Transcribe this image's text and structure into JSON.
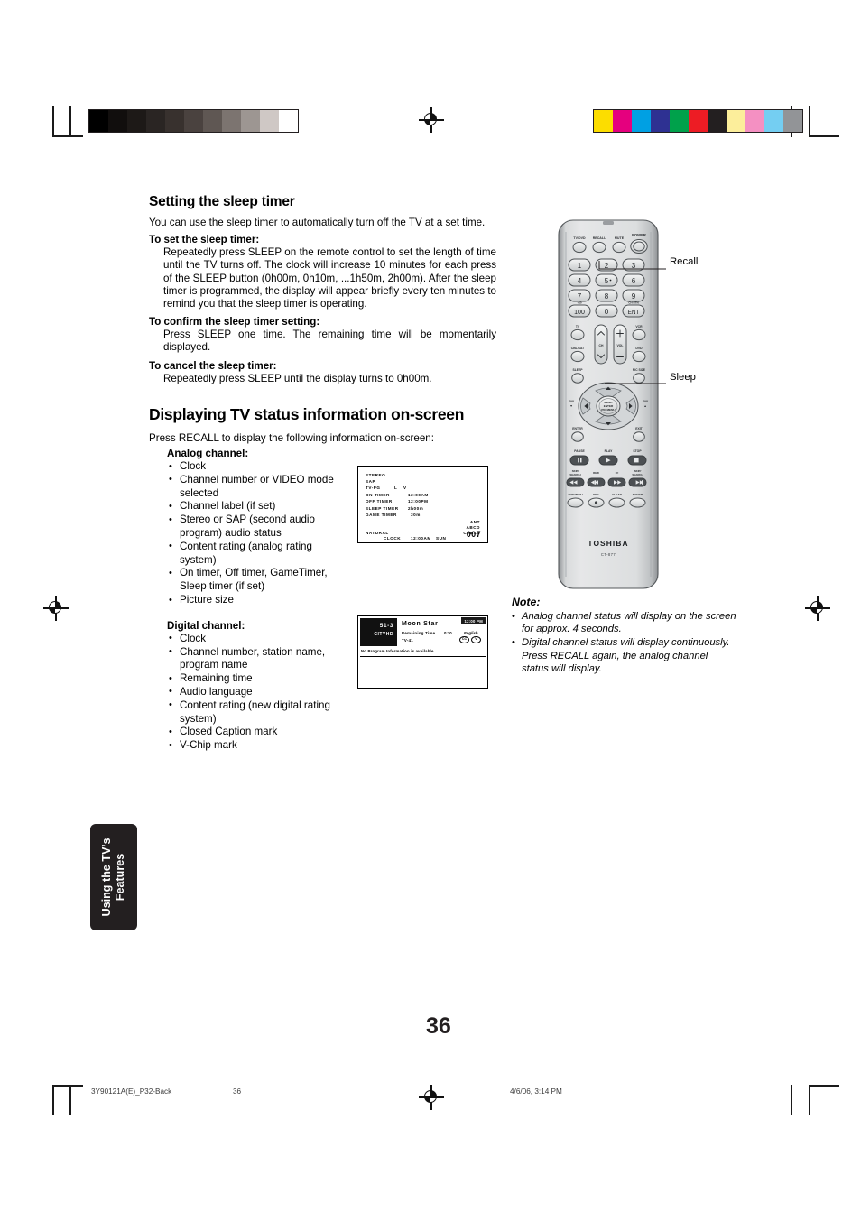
{
  "page": {
    "number": "36",
    "side_tab_line1": "Using the TV's",
    "side_tab_line2": "Features"
  },
  "sections": [
    {
      "id": "sleep-timer",
      "heading": "Setting the sleep timer",
      "intro": "You can use the sleep timer to automatically turn off the TV at a set time.",
      "blocks": [
        {
          "subhead": "To set the sleep timer:",
          "text": "Repeatedly press SLEEP on the remote control to set the length of time until the TV turns off. The clock will increase 10 minutes for each press of the SLEEP button (0h00m, 0h10m, ...1h50m, 2h00m). After the sleep timer is programmed, the display will appear briefly every ten minutes to remind you that the sleep timer is operating."
        },
        {
          "subhead": "To confirm the sleep timer setting:",
          "text": "Press SLEEP one time. The remaining time will be momentarily displayed."
        },
        {
          "subhead": "To cancel the sleep timer:",
          "text": "Repeatedly press SLEEP until the display turns to 0h00m."
        }
      ]
    },
    {
      "id": "tv-status",
      "heading": "Displaying TV status information on-screen",
      "intro": "Press RECALL to display the following information on-screen:",
      "groups": [
        {
          "title": "Analog channel:",
          "items": [
            "Clock",
            "Channel number or VIDEO mode selected",
            "Channel label (if set)",
            "Stereo or SAP (second audio program) audio status",
            "Content rating (analog rating system)",
            "On timer, Off timer, GameTimer, Sleep timer (if set)",
            "Picture size"
          ]
        },
        {
          "title": "Digital channel:",
          "items": [
            "Clock",
            "Channel number, station name, program name",
            "Remaining time",
            "Audio language",
            "Content rating (new digital rating system)",
            "Closed Caption mark",
            "V-Chip mark"
          ]
        }
      ]
    }
  ],
  "osd_analog": {
    "stereo": "STEREO",
    "sap": "SAP",
    "rating": "TV-PG",
    "rating_l": "L",
    "rating_v": "V",
    "on_timer_label": "ON TIMER",
    "on_timer_value": "12:00AM",
    "off_timer_label": "OFF TIMER",
    "off_timer_value": "12:00PM",
    "sleep_timer_label": "SLEEP TIMER",
    "sleep_timer_value": "2h00m",
    "game_timer_label": "GAME TIMER",
    "game_timer_value": "30m",
    "ant": "ANT",
    "label": "ABCD",
    "source": "CABLE",
    "picture_size": "NATURAL",
    "clock_label": "CLOCK",
    "clock_value": "12:00AM",
    "clock_day": "SUN",
    "channel": "007"
  },
  "osd_digital": {
    "channel": "51-3",
    "station": "CITYHD",
    "program": "Moon Star",
    "remaining_label": "Remaining Time",
    "remaining_value": "0:30",
    "rating": "TV-41",
    "language": "English",
    "time": "12:00 PM",
    "cc_mark": "CC",
    "vchip_mark": "V",
    "no_info": "No Program Information is available."
  },
  "remote": {
    "brand": "TOSHIBA",
    "model": "CT-877",
    "callouts": [
      {
        "name": "recall",
        "label": "Recall"
      },
      {
        "name": "sleep",
        "label": "Sleep"
      }
    ],
    "buttons": {
      "tv_dvd": "TV/DVD",
      "recall": "RECALL",
      "mute": "MUTE",
      "power": "POWER",
      "n1": "1",
      "n2": "2",
      "n3": "3",
      "n4": "4",
      "n5": "5",
      "n6": "6",
      "n7": "7",
      "n8": "8",
      "n9": "9",
      "n100": "100",
      "n0": "0",
      "ent": "ENT",
      "ent_top": "CH RTN",
      "n100_top": "+10",
      "tv": "TV",
      "vcr": "VCR",
      "cbl_sat": "CBL/SAT",
      "dvd": "DVD",
      "ch": "CH",
      "vol": "VOL",
      "sleep": "SLEEP",
      "pic_size": "PIC SIZE",
      "menu_enter": "MENU\nENTER\nPIC MENU",
      "fav_down": "FAV",
      "fav_up": "FAV",
      "enter": "ENTER",
      "exit": "EXIT",
      "pause": "PAUSE",
      "play": "PLAY",
      "stop": "STOP",
      "skip_search_l": "SKIP/ SEARCH",
      "rew": "REW",
      "ff": "FF",
      "skip_search_r": "SKIP/ SEARCH",
      "top_menu": "TOP MENU",
      "rec": "REC",
      "clear": "CLEAR",
      "tv_vcr": "TV/VCR"
    }
  },
  "note": {
    "heading": "Note:",
    "items": [
      "Analog channel status will display on the screen for approx. 4 seconds.",
      "Digital channel status will display continuously. Press RECALL again, the analog channel status will display."
    ]
  },
  "footer": {
    "file": "3Y90121A(E)_P32-Back",
    "page": "36",
    "timestamp": "4/6/06, 3:14 PM"
  },
  "colorbars": {
    "gray_scale": [
      "#000000",
      "#110e0d",
      "#1d1917",
      "#2a2523",
      "#38312e",
      "#4a423f",
      "#5f5753",
      "#7c7470",
      "#9d9692",
      "#cfc8c5",
      "#ffffff"
    ],
    "process": [
      "#fcdd00",
      "#e5007e",
      "#00a0e3",
      "#2e3192",
      "#00a14b",
      "#ed1c24",
      "#231f20",
      "#fcee9b",
      "#f490c2",
      "#74cef2",
      "#929497"
    ]
  }
}
